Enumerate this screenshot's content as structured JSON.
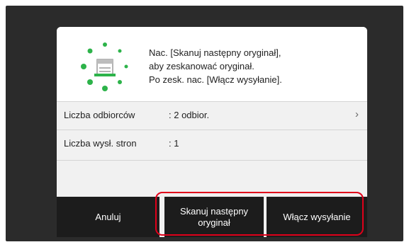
{
  "dialog": {
    "status_icon": "scanning-spinner-icon",
    "message_lines": [
      "Nac. [Skanuj następny oryginał],",
      "aby zeskanować oryginał.",
      "Po zesk. nac. [Włącz wysyłanie]."
    ]
  },
  "rows": [
    {
      "label": "Liczba odbiorców",
      "value": ":  2 odbior.",
      "chevron": "›"
    },
    {
      "label": "Liczba wysł. stron",
      "value": ":  1"
    }
  ],
  "buttons": {
    "cancel": "Anuluj",
    "next_line1": "Skanuj następny",
    "next_line2": "oryginał",
    "send": "Włącz wysyłanie"
  },
  "colors": {
    "spinner_green": "#2db34a",
    "highlight_red": "#e0001a",
    "button_dark": "#1c1c1c"
  }
}
